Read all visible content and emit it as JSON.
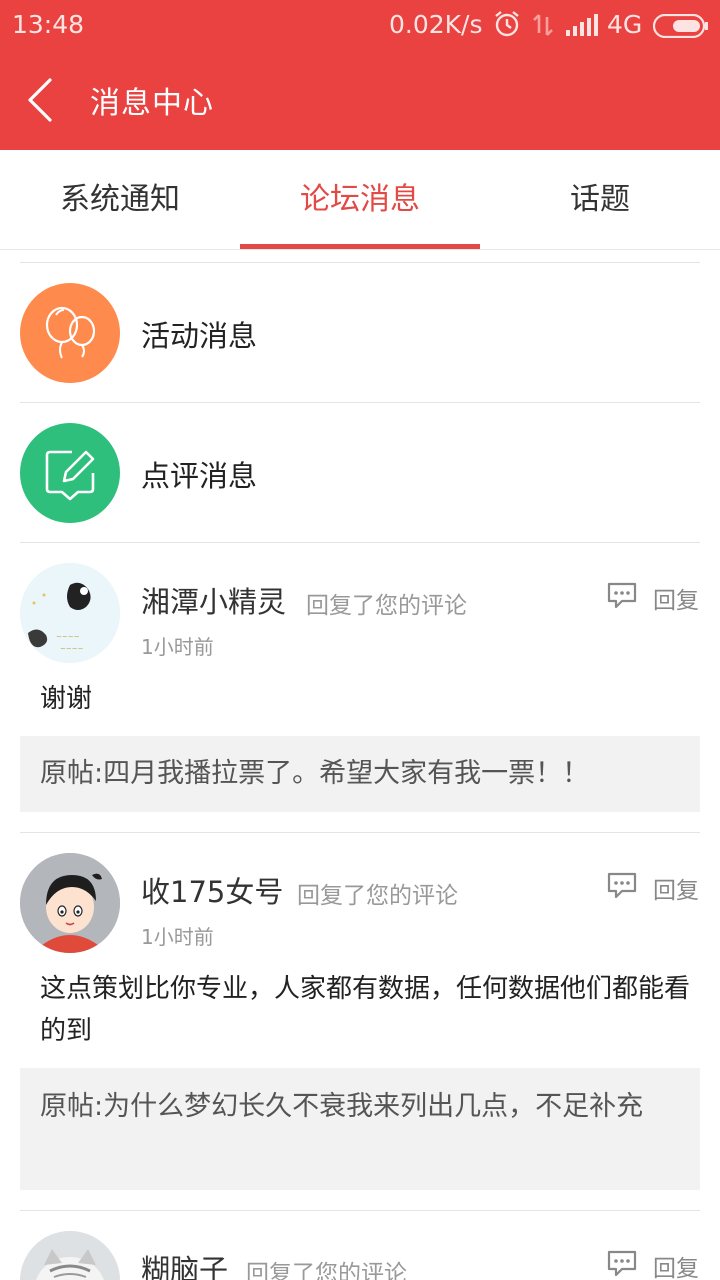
{
  "status_bar": {
    "time": "13:48",
    "speed": "0.02K/s",
    "network": "4G"
  },
  "header": {
    "title": "消息中心",
    "background": "#ea4240"
  },
  "tabs": [
    {
      "label": "系统通知",
      "active": false
    },
    {
      "label": "论坛消息",
      "active": true
    },
    {
      "label": "话题",
      "active": false
    }
  ],
  "categories": [
    {
      "label": "活动消息",
      "icon": "balloon-icon",
      "color": "#ff8a4d"
    },
    {
      "label": "点评消息",
      "icon": "edit-comment-icon",
      "color": "#2ebf7c"
    }
  ],
  "messages": [
    {
      "user": "湘潭小精灵",
      "action": "回复了您的评论",
      "time": "1小时前",
      "reply_label": "回复",
      "content": "谢谢",
      "original": "原帖:四月我播拉票了。希望大家有我一票！！"
    },
    {
      "user": "收175女号",
      "action": "回复了您的评论",
      "time": "1小时前",
      "reply_label": "回复",
      "content": "这点策划比你专业，人家都有数据，任何数据他们都能看的到",
      "original": "原帖:为什么梦幻长久不衰我来列出几点，不足补充"
    },
    {
      "user": "糊脑子",
      "action": "回复了您的评论",
      "reply_label": "回复"
    }
  ],
  "colors": {
    "accent": "#e34a45",
    "muted_text": "#999999",
    "quote_bg": "#f2f2f2"
  }
}
